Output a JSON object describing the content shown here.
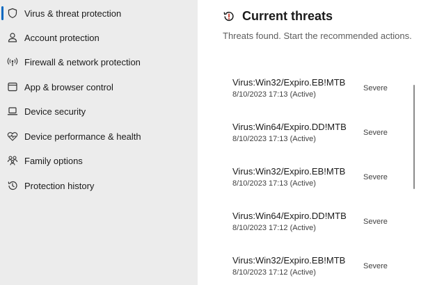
{
  "sidebar": {
    "items": [
      {
        "label": "Virus & threat protection",
        "icon": "shield-icon",
        "selected": true
      },
      {
        "label": "Account protection",
        "icon": "person-icon"
      },
      {
        "label": "Firewall & network protection",
        "icon": "antenna-icon"
      },
      {
        "label": "App & browser control",
        "icon": "app-window-icon"
      },
      {
        "label": "Device security",
        "icon": "laptop-icon"
      },
      {
        "label": "Device performance & health",
        "icon": "heart-pulse-icon"
      },
      {
        "label": "Family options",
        "icon": "family-icon"
      },
      {
        "label": "Protection history",
        "icon": "history-icon"
      }
    ]
  },
  "main": {
    "title": "Current threats",
    "title_icon": "history-warning-icon",
    "subtitle": "Threats found. Start the recommended actions.",
    "threats": [
      {
        "name": "Virus:Win32/Expiro.EB!MTB",
        "date": "8/10/2023 17:13 (Active)",
        "severity": "Severe"
      },
      {
        "name": "Virus:Win64/Expiro.DD!MTB",
        "date": "8/10/2023 17:13 (Active)",
        "severity": "Severe"
      },
      {
        "name": "Virus:Win32/Expiro.EB!MTB",
        "date": "8/10/2023 17:13 (Active)",
        "severity": "Severe"
      },
      {
        "name": "Virus:Win64/Expiro.DD!MTB",
        "date": "8/10/2023 17:12 (Active)",
        "severity": "Severe"
      },
      {
        "name": "Virus:Win32/Expiro.EB!MTB",
        "date": "8/10/2023 17:12 (Active)",
        "severity": "Severe"
      }
    ]
  },
  "colors": {
    "accent": "#0067c0",
    "sidebar_bg": "#ececec"
  }
}
